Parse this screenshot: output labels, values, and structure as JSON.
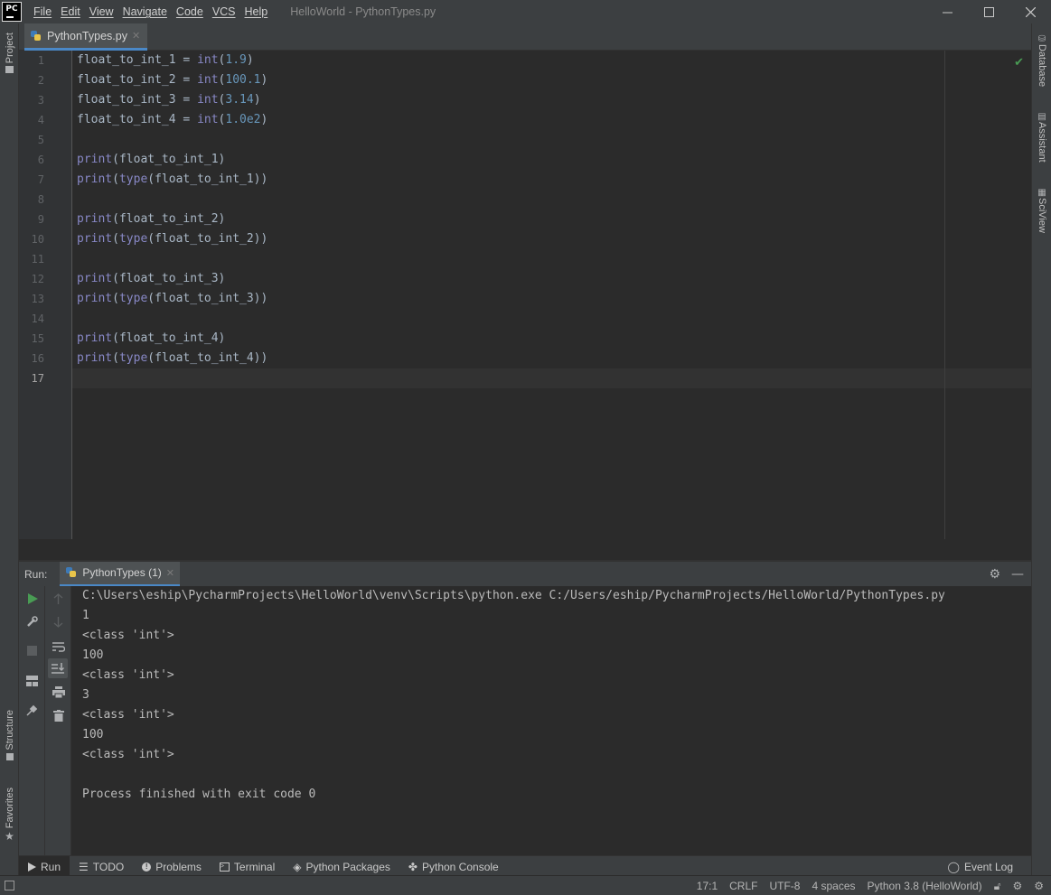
{
  "app": {
    "logo_text": "PC",
    "window_title": "HelloWorld - PythonTypes.py"
  },
  "menu": [
    "File",
    "Edit",
    "View",
    "Navigate",
    "Code",
    "VCS",
    "Help"
  ],
  "left_strip": {
    "top": "Project",
    "structure": "Structure",
    "favorites": "Favorites"
  },
  "right_strip": [
    "Database",
    "Assistant",
    "SciView"
  ],
  "editor": {
    "tab_label": "PythonTypes.py",
    "lines": [
      {
        "n": "1",
        "html": "float_to_int_1 = <span class=\"fn\">int</span>(<span class=\"num\">1.9</span>)"
      },
      {
        "n": "2",
        "html": "float_to_int_2 = <span class=\"fn\">int</span>(<span class=\"num\">100.1</span>)"
      },
      {
        "n": "3",
        "html": "float_to_int_3 = <span class=\"fn\">int</span>(<span class=\"num\">3.14</span>)"
      },
      {
        "n": "4",
        "html": "float_to_int_4 = <span class=\"fn\">int</span>(<span class=\"num\">1.0e2</span>)"
      },
      {
        "n": "5",
        "html": ""
      },
      {
        "n": "6",
        "html": "<span class=\"fn\">print</span>(float_to_int_1)"
      },
      {
        "n": "7",
        "html": "<span class=\"fn\">print</span>(<span class=\"fn\">type</span>(float_to_int_1))"
      },
      {
        "n": "8",
        "html": ""
      },
      {
        "n": "9",
        "html": "<span class=\"fn\">print</span>(float_to_int_2)"
      },
      {
        "n": "10",
        "html": "<span class=\"fn\">print</span>(<span class=\"fn\">type</span>(float_to_int_2))"
      },
      {
        "n": "11",
        "html": ""
      },
      {
        "n": "12",
        "html": "<span class=\"fn\">print</span>(float_to_int_3)"
      },
      {
        "n": "13",
        "html": "<span class=\"fn\">print</span>(<span class=\"fn\">type</span>(float_to_int_3))"
      },
      {
        "n": "14",
        "html": ""
      },
      {
        "n": "15",
        "html": "<span class=\"fn\">print</span>(float_to_int_4)"
      },
      {
        "n": "16",
        "html": "<span class=\"fn\">print</span>(<span class=\"fn\">type</span>(float_to_int_4))"
      },
      {
        "n": "17",
        "html": ""
      }
    ]
  },
  "run": {
    "title": "Run:",
    "tab_label": "PythonTypes (1)",
    "output": [
      "C:\\Users\\eship\\PycharmProjects\\HelloWorld\\venv\\Scripts\\python.exe C:/Users/eship/PycharmProjects/HelloWorld/PythonTypes.py",
      "1",
      "<class 'int'>",
      "100",
      "<class 'int'>",
      "3",
      "<class 'int'>",
      "100",
      "<class 'int'>",
      "",
      "Process finished with exit code 0"
    ]
  },
  "bottom_bar": {
    "run": "Run",
    "todo": "TODO",
    "problems": "Problems",
    "terminal": "Terminal",
    "python_packages": "Python Packages",
    "python_console": "Python Console",
    "event_log": "Event Log"
  },
  "status": {
    "position": "17:1",
    "line_sep": "CRLF",
    "encoding": "UTF-8",
    "indent": "4 spaces",
    "interpreter": "Python 3.8 (HelloWorld)"
  },
  "colors": {
    "accent": "#4a88c7",
    "run_green": "#499c54",
    "keyword": "#8888c6",
    "number": "#6897bb"
  }
}
